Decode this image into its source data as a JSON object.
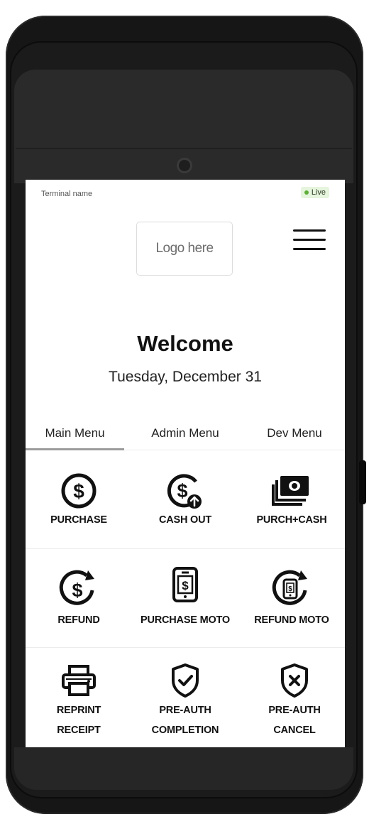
{
  "header": {
    "terminal_name": "Terminal name",
    "status": "Live",
    "logo_text": "Logo here"
  },
  "welcome": {
    "title": "Welcome",
    "date": "Tuesday, December 31"
  },
  "tabs": [
    {
      "label": "Main Menu",
      "active": true
    },
    {
      "label": "Admin Menu",
      "active": false
    },
    {
      "label": "Dev Menu",
      "active": false
    }
  ],
  "menu": {
    "purchase": {
      "label": "PURCHASE",
      "icon": "dollar-circle-icon"
    },
    "cash_out": {
      "label": "CASH OUT",
      "icon": "dollar-cash-out-icon"
    },
    "purch_cash": {
      "label": "PURCH+CASH",
      "icon": "cash-stack-icon"
    },
    "refund": {
      "label": "REFUND",
      "icon": "dollar-refund-icon"
    },
    "purchase_moto": {
      "label": "PURCHASE MOTO",
      "icon": "phone-dollar-icon"
    },
    "refund_moto": {
      "label": "REFUND MOTO",
      "icon": "phone-refund-icon"
    },
    "reprint_receipt": {
      "line1": "REPRINT",
      "line2": "RECEIPT",
      "icon": "printer-icon"
    },
    "preauth_completion": {
      "line1": "PRE-AUTH",
      "line2": "COMPLETION",
      "icon": "shield-check-icon"
    },
    "preauth_cancel": {
      "line1": "PRE-AUTH",
      "line2": "CANCEL",
      "icon": "shield-x-icon"
    }
  },
  "colors": {
    "live_badge_bg": "#e6f5dd",
    "live_dot": "#5fae3b",
    "device_body": "#161616",
    "active_tab_underline": "#9c9c9c"
  }
}
